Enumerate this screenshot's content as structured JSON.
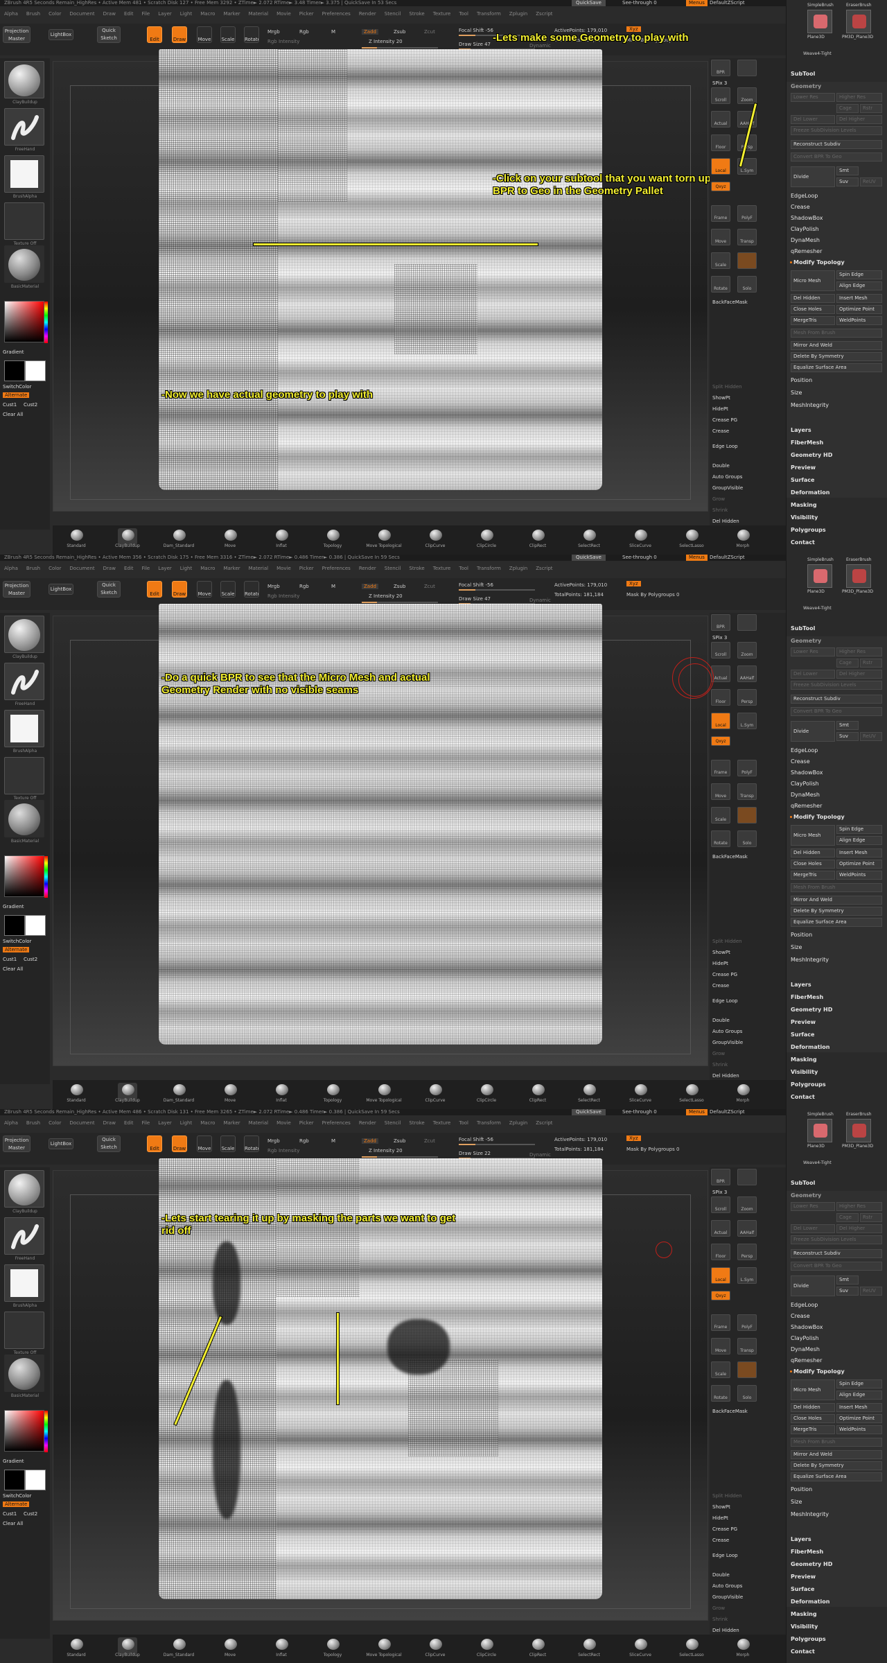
{
  "panels": [
    {
      "titlebar": "ZBrush 4R5    Seconds Remain_HighRes  • Active Mem 481 • Scratch Disk 127 • Free Mem 3292 • ZTime► 2.072 RTime► 3.48 Timer► 3.375 | QuickSave In 53 Secs",
      "brush_label": "Draw Size 47",
      "rgb_label": "Mrgb",
      "annotations": [
        "-Lets make some Geometry to play with",
        "-Click on your subtool that you want torn up and click on BPR to Geo in the Geometry Pallet",
        "-Now we have actual geometry to play with"
      ]
    },
    {
      "titlebar": "ZBrush 4R5    Seconds Remain_HighRes  • Active Mem 356 • Scratch Disk 175 • Free Mem 3316 • ZTime► 2.072 RTime► 0.486 Timer► 0.386 | QuickSave In 59 Secs",
      "brush_label": "Draw Size 47",
      "rgb_label": "Mrgb",
      "annotations": [
        "-Do a quick BPR to see that the Micro Mesh and actual Geometry Render with no visible seams"
      ]
    },
    {
      "titlebar": "ZBrush 4R5    Seconds Remain_HighRes  • Active Mem 486 • Scratch Disk 131 • Free Mem 3265 • ZTime► 2.072 RTime► 0.486 Timer► 0.386 | QuickSave In 59 Secs",
      "brush_label": "Draw Size 22",
      "rgb_label": "Mrgb",
      "annotations": [
        "-Lets start tearing it up by masking the parts we want to get rid off"
      ]
    }
  ],
  "menu": [
    "Alpha",
    "Brush",
    "Color",
    "Document",
    "Draw",
    "Edit",
    "File",
    "Layer",
    "Light",
    "Macro",
    "Marker",
    "Material",
    "Movie",
    "Picker",
    "Preferences",
    "Render",
    "Stencil",
    "Stroke",
    "Texture",
    "Tool",
    "Transform",
    "Zplugin",
    "Zscript"
  ],
  "topbar": {
    "quicksave": "QuickSave",
    "seethrough": "See-through 0",
    "menus": "Menus",
    "defaultzscript": "DefaultZScript",
    "projection_master": "Projection Master",
    "lightbox": "LightBox",
    "quick_sketch": "Quick Sketch",
    "edit": "Edit",
    "draw": "Draw",
    "move": "Move",
    "scale": "Scale",
    "rotate": "Rotate",
    "mrgb": "Mrgb",
    "rgb": "Rgb",
    "m": "M",
    "rgb_intensity": "Rgb Intensity",
    "zadd": "Zadd",
    "zsub": "Zsub",
    "zcut": "Zcut",
    "z_intensity": "Z Intensity 20",
    "focal_shift": "Focal Shift -56",
    "dynamic": "Dynamic",
    "active_points": "ActivePoints: 179,010",
    "total_points": "TotalPoints: 181,184",
    "xyz": "Xyz",
    "mask_polygroups": "Mask By Polygroups 0"
  },
  "left": {
    "standard": "ClayBuildup",
    "freehand": "FreeHand",
    "brush_alpha": "BrushAlpha",
    "texture_off": "Texture Off",
    "material": "BasicMaterial",
    "gradient": "Gradient",
    "switchcolor": "SwitchColor",
    "alternate": "Alternate",
    "cust1": "Cust1",
    "cust2": "Cust2",
    "clear_all": "Clear All"
  },
  "right": {
    "bpr": "BPR",
    "spix": "SPix 3",
    "scroll": "Scroll",
    "zoom": "Zoom",
    "actual": "Actual",
    "aahalf": "AAHalf",
    "floor": "Floor",
    "persp": "Persp",
    "local": "Local",
    "lsym": "L.Sym",
    "xyz": "Qxyz",
    "frame": "Frame",
    "move": "Move",
    "scale": "Scale",
    "rotate": "Rotate",
    "polyf": "PolyF",
    "transp": "Transp",
    "solo": "Solo",
    "backfacemask": "BackFaceMask",
    "split_hidden": "Split Hidden",
    "showpt": "ShowPt",
    "hidept": "HidePt",
    "crease_pg": "Crease PG",
    "crease": "Crease",
    "edge_loop": "Edge Loop",
    "double": "Double",
    "auto_groups": "Auto Groups",
    "group_visible": "GroupVisible",
    "grow": "Grow",
    "shrink": "Shrink",
    "del_hidden": "Del Hidden"
  },
  "palette": {
    "thumb1": "SimpleBrush",
    "thumb2": "EraserBrush",
    "thumb3": "Plane3D",
    "thumb4": "PM3D_Plane3D",
    "thumb5": "Weave4-Tight",
    "subtool": "SubTool",
    "geometry": "Geometry",
    "lower_res": "Lower Res",
    "higher_res": "Higher Res",
    "cage": "Cage",
    "rstr": "Rstr",
    "del_lower": "Del Lower",
    "del_higher": "Del Higher",
    "freeze": "Freeze SubDivision Levels",
    "reconstruct": "Reconstruct Subdiv",
    "convert_bpr": "Convert BPR To Geo",
    "divide": "Divide",
    "smt": "Smt",
    "suv": "Suv",
    "reuv": "ReUV",
    "edgeloop": "EdgeLoop",
    "crease": "Crease",
    "shadowbox": "ShadowBox",
    "claypolish": "ClayPolish",
    "dynamesh": "DynaMesh",
    "qremesher": "qRemesher",
    "modify_topology": "Modify Topology",
    "micro_mesh": "Micro Mesh",
    "spin_edge": "Spin Edge",
    "align_edge": "Align Edge",
    "del_hidden": "Del Hidden",
    "insert_mesh": "Insert Mesh",
    "close_holes": "Close Holes",
    "optimize_point": "Optimize Point",
    "mergetris": "MergeTris",
    "weldpoints": "WeldPoints",
    "mesh_from_brush": "Mesh From Brush",
    "mirror_weld": "Mirror And Weld",
    "delete_symmetry": "Delete By Symmetry",
    "equalize": "Equalize Surface Area",
    "position": "Position",
    "size": "Size",
    "meshintegrity": "MeshIntegrity",
    "layers": "Layers",
    "fibermesh": "FiberMesh",
    "geometry_hd": "Geometry HD",
    "preview": "Preview",
    "surface": "Surface",
    "deformation": "Deformation",
    "masking": "Masking",
    "visibility": "Visibility",
    "polygroups": "Polygroups",
    "contact": "Contact"
  },
  "shelf": [
    "Standard",
    "ClayBuildup",
    "Dam_Standard",
    "Move",
    "Inflat",
    "Topology",
    "Move Topological",
    "ClipCurve",
    "ClipCircle",
    "ClipRect",
    "SelectRect",
    "SliceCurve",
    "SelectLasso",
    "Morph"
  ],
  "colors": {
    "accent": "#f07a14",
    "annotation": "#f2ee30",
    "bg": "#2b2b2b"
  }
}
